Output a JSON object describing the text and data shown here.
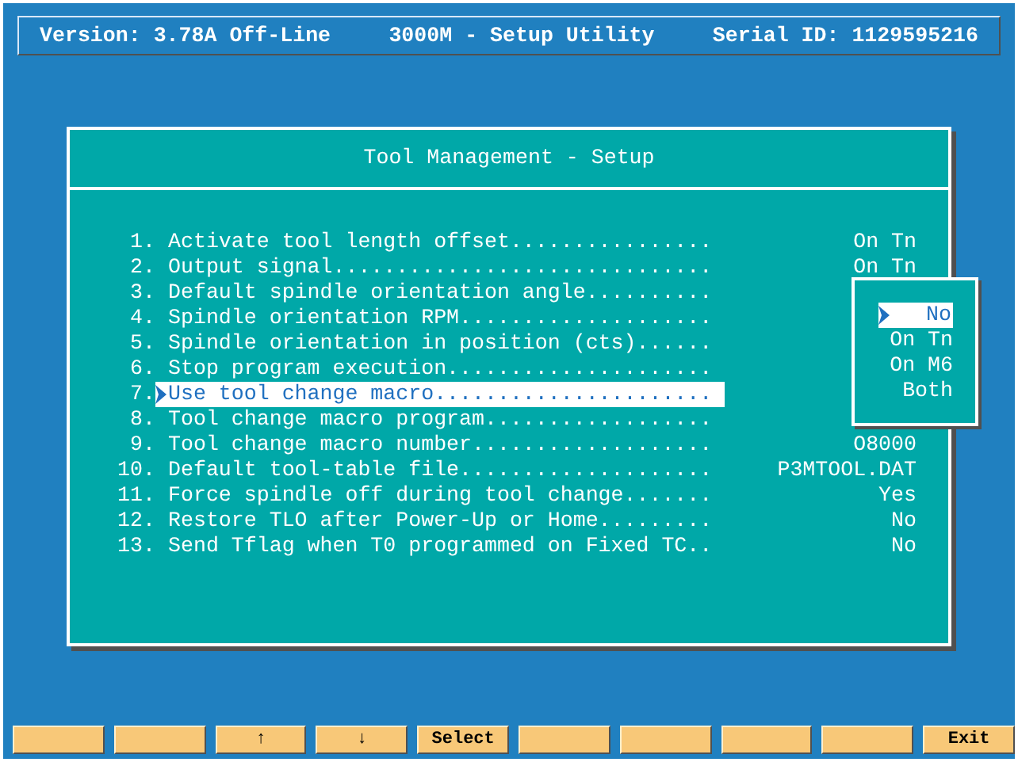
{
  "header": {
    "version": "Version: 3.78A Off-Line",
    "title": "3000M - Setup Utility",
    "serial": "Serial ID: 1129595216"
  },
  "dialog": {
    "title": "Tool Management - Setup",
    "items": [
      {
        "number": "1.",
        "label": "Activate tool length offset................",
        "value": "On Tn",
        "selected": false
      },
      {
        "number": "2.",
        "label": "Output signal..............................",
        "value": "On Tn",
        "selected": false
      },
      {
        "number": "3.",
        "label": "Default spindle orientation angle..........",
        "selected": false
      },
      {
        "number": "4.",
        "label": "Spindle orientation RPM....................",
        "selected": false
      },
      {
        "number": "5.",
        "label": "Spindle orientation in position (cts)......",
        "selected": false
      },
      {
        "number": "6.",
        "label": "Stop program execution.....................",
        "selected": false
      },
      {
        "number": "7.",
        "label": "Use tool change macro......................",
        "selected": true
      },
      {
        "number": "8.",
        "label": "Tool change macro program..................",
        "selected": false
      },
      {
        "number": "9.",
        "label": "Tool change macro number...................",
        "value": "O8000",
        "selected": false
      },
      {
        "number": "10.",
        "label": "Default tool-table file....................",
        "value": "P3MTOOL.DAT",
        "selected": false
      },
      {
        "number": "11.",
        "label": "Force spindle off during tool change.......",
        "value": "Yes",
        "selected": false
      },
      {
        "number": "12.",
        "label": "Restore TLO after Power-Up or Home.........",
        "value": "No",
        "selected": false
      },
      {
        "number": "13.",
        "label": "Send Tflag when T0 programmed on Fixed TC..",
        "value": "No",
        "selected": false
      }
    ],
    "popup": {
      "options": [
        {
          "label": "No",
          "selected": true
        },
        {
          "label": "On Tn",
          "selected": false
        },
        {
          "label": "On M6",
          "selected": false
        },
        {
          "label": "Both",
          "selected": false
        }
      ]
    }
  },
  "function_keys": [
    {
      "kind": "blank"
    },
    {
      "kind": "blank"
    },
    {
      "kind": "label",
      "label": "↑"
    },
    {
      "kind": "label",
      "label": "↓"
    },
    {
      "kind": "label",
      "label": "Select"
    },
    {
      "kind": "blank"
    },
    {
      "kind": "blank"
    },
    {
      "kind": "blank"
    },
    {
      "kind": "blank"
    },
    {
      "kind": "label",
      "label": "Exit"
    }
  ]
}
